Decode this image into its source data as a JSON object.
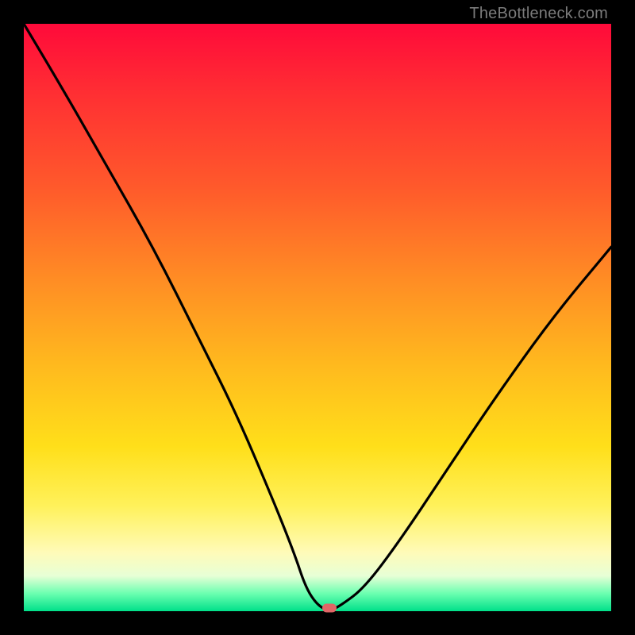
{
  "watermark": "TheBottleneck.com",
  "marker": {
    "x_pct": 52,
    "y_pct": 100
  },
  "chart_data": {
    "type": "line",
    "title": "",
    "xlabel": "",
    "ylabel": "",
    "xlim": [
      0,
      100
    ],
    "ylim": [
      0,
      100
    ],
    "series": [
      {
        "name": "bottleneck-curve",
        "x": [
          0,
          6,
          14,
          22,
          30,
          36,
          42,
          46,
          48,
          50,
          52,
          54,
          58,
          64,
          72,
          80,
          90,
          100
        ],
        "y": [
          100,
          90,
          76,
          62,
          46,
          34,
          20,
          10,
          4,
          1,
          0,
          1,
          4,
          12,
          24,
          36,
          50,
          62
        ]
      }
    ],
    "annotations": [
      {
        "type": "marker",
        "x": 52,
        "y": 0,
        "shape": "pill",
        "color": "#e06666"
      }
    ],
    "background_gradient": {
      "direction": "vertical",
      "stops": [
        {
          "pct": 0,
          "color": "#ff0a3a"
        },
        {
          "pct": 28,
          "color": "#ff5a2b"
        },
        {
          "pct": 58,
          "color": "#ffb91e"
        },
        {
          "pct": 82,
          "color": "#fff15a"
        },
        {
          "pct": 94,
          "color": "#e7ffd6"
        },
        {
          "pct": 100,
          "color": "#00e08a"
        }
      ]
    }
  }
}
